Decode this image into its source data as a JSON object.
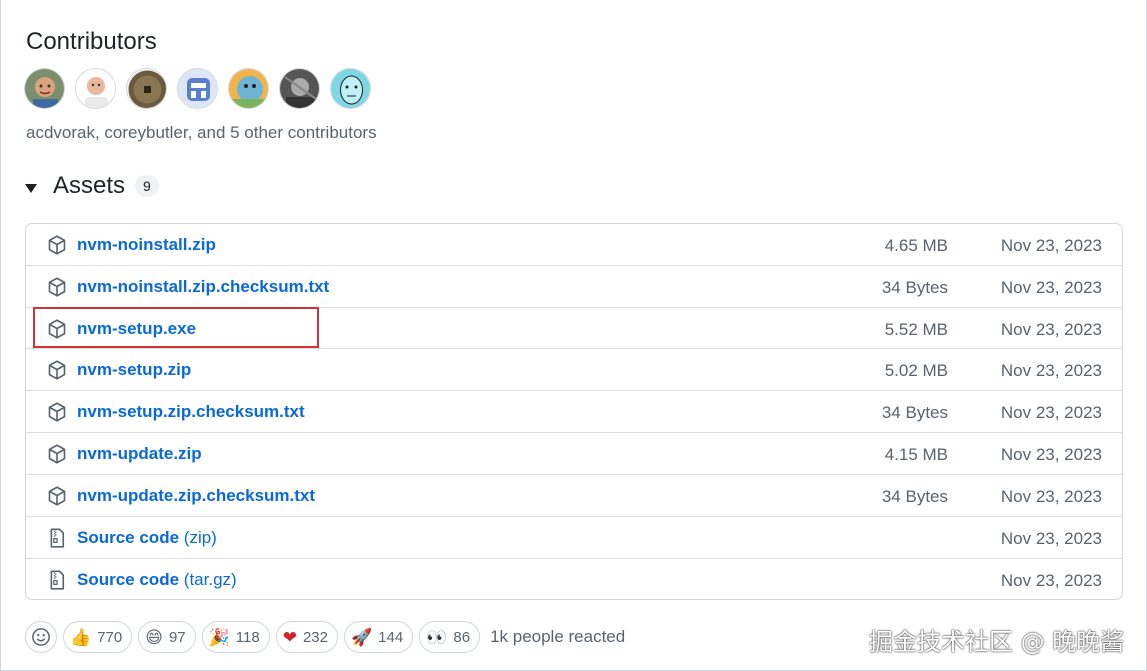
{
  "contributors": {
    "title": "Contributors",
    "summary": "acdvorak, coreybutler, and 5 other contributors",
    "avatars": [
      "avatar-1",
      "avatar-2",
      "avatar-3",
      "avatar-4",
      "avatar-5",
      "avatar-6",
      "avatar-7"
    ]
  },
  "assets": {
    "title": "Assets",
    "count": "9",
    "rows": [
      {
        "name": "nvm-noinstall.zip",
        "ext": "",
        "size": "4.65 MB",
        "date": "Nov 23, 2023",
        "icon": "package-icon"
      },
      {
        "name": "nvm-noinstall.zip.checksum.txt",
        "ext": "",
        "size": "34 Bytes",
        "date": "Nov 23, 2023",
        "icon": "package-icon"
      },
      {
        "name": "nvm-setup.exe",
        "ext": "",
        "size": "5.52 MB",
        "date": "Nov 23, 2023",
        "icon": "package-icon"
      },
      {
        "name": "nvm-setup.zip",
        "ext": "",
        "size": "5.02 MB",
        "date": "Nov 23, 2023",
        "icon": "package-icon"
      },
      {
        "name": "nvm-setup.zip.checksum.txt",
        "ext": "",
        "size": "34 Bytes",
        "date": "Nov 23, 2023",
        "icon": "package-icon"
      },
      {
        "name": "nvm-update.zip",
        "ext": "",
        "size": "4.15 MB",
        "date": "Nov 23, 2023",
        "icon": "package-icon"
      },
      {
        "name": "nvm-update.zip.checksum.txt",
        "ext": "",
        "size": "34 Bytes",
        "date": "Nov 23, 2023",
        "icon": "package-icon"
      },
      {
        "name": "Source code",
        "ext": "(zip)",
        "size": "",
        "date": "Nov 23, 2023",
        "icon": "file-zip-icon"
      },
      {
        "name": "Source code",
        "ext": "(tar.gz)",
        "size": "",
        "date": "Nov 23, 2023",
        "icon": "file-zip-icon"
      }
    ]
  },
  "reactions": {
    "items": [
      {
        "emoji": "👍",
        "count": "770",
        "icon": "thumbs-up-icon"
      },
      {
        "emoji": "😄",
        "count": "97",
        "icon": "laugh-icon"
      },
      {
        "emoji": "🎉",
        "count": "118",
        "icon": "hooray-icon"
      },
      {
        "emoji": "❤",
        "count": "232",
        "icon": "heart-icon"
      },
      {
        "emoji": "🚀",
        "count": "144",
        "icon": "rocket-icon"
      },
      {
        "emoji": "👀",
        "count": "86",
        "icon": "eyes-icon"
      }
    ],
    "summary": "1k people reacted"
  },
  "watermark": "掘金技术社区 @ 晚晚酱",
  "colors": {
    "link": "#0969da",
    "muted": "#59636e",
    "highlight": "#d0343a"
  }
}
